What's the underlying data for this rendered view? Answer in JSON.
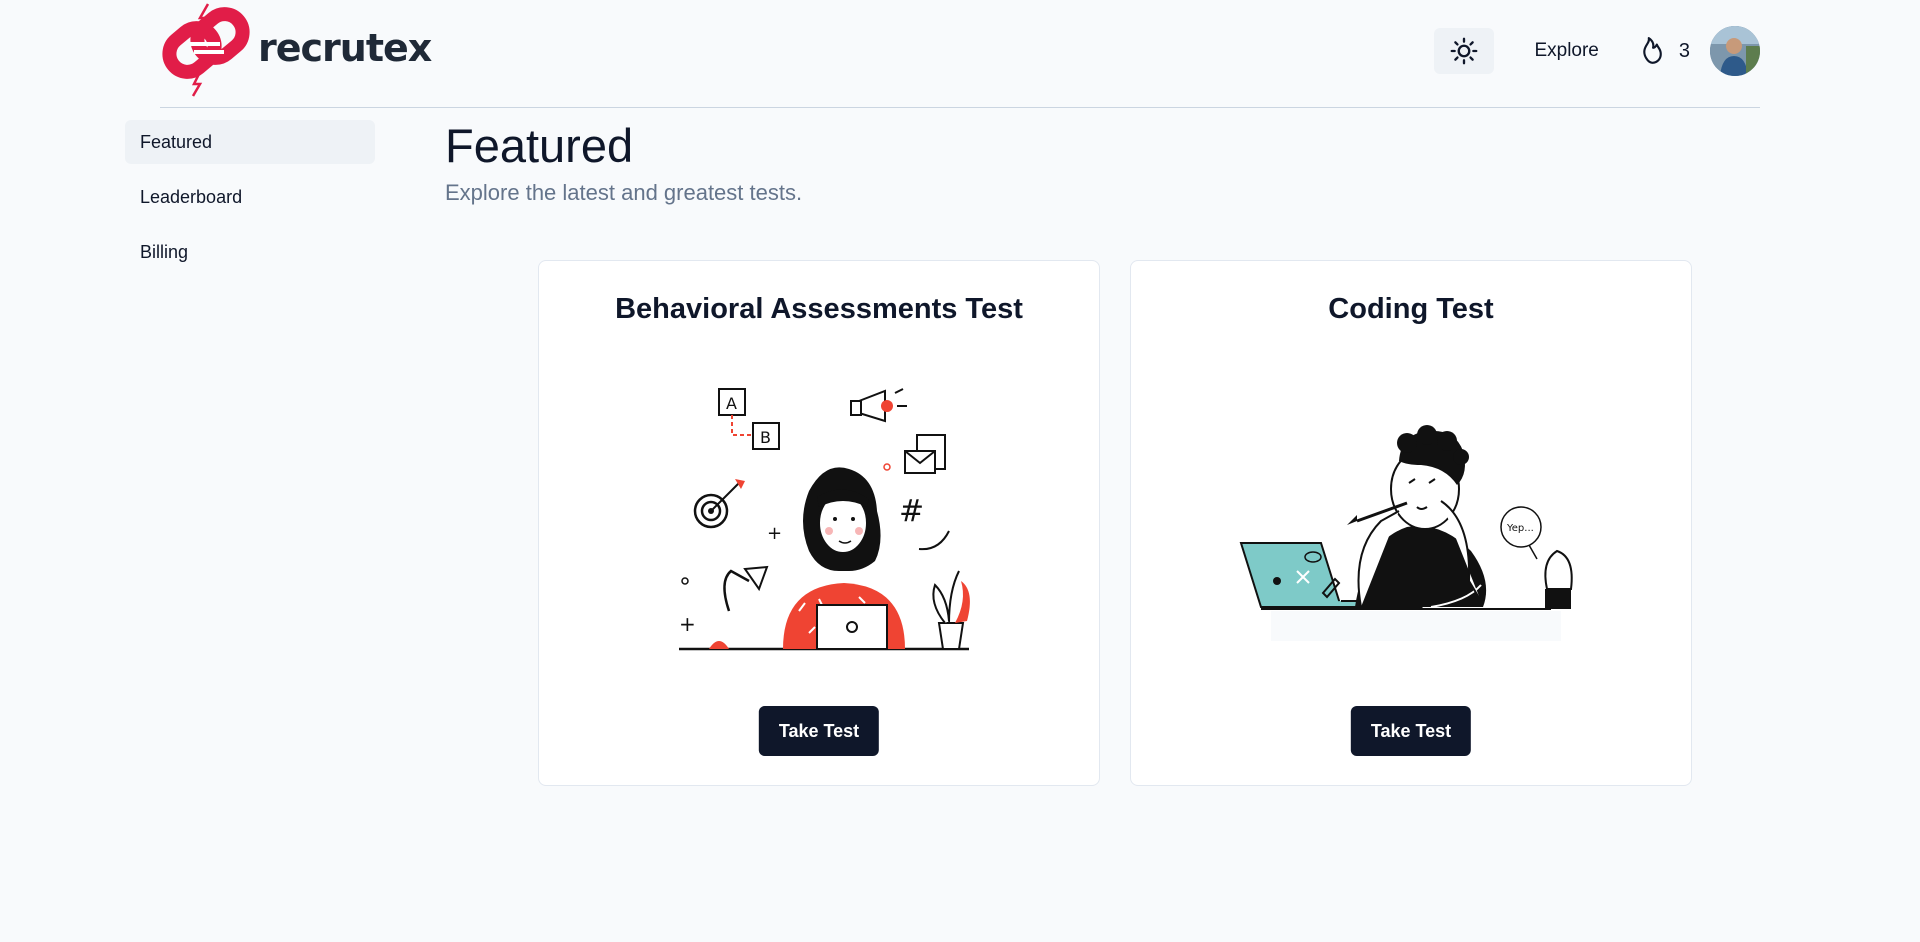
{
  "brand": {
    "name": "recrutex",
    "accent": "#e11d48"
  },
  "header": {
    "theme_icon": "sun-icon",
    "explore_label": "Explore",
    "streak_icon": "flame-icon",
    "streak_count": "3"
  },
  "sidebar": {
    "items": [
      {
        "label": "Featured",
        "active": true
      },
      {
        "label": "Leaderboard",
        "active": false
      },
      {
        "label": "Billing",
        "active": false
      }
    ]
  },
  "main": {
    "title": "Featured",
    "subtitle": "Explore the latest and greatest tests.",
    "cards": [
      {
        "title": "Behavioral Assessments Test",
        "button_label": "Take Test",
        "illustration": "woman-at-laptop-illustration"
      },
      {
        "title": "Coding Test",
        "button_label": "Take Test",
        "illustration": "thinking-person-laptop-illustration"
      }
    ]
  },
  "illustration_text": {
    "bubble": "Yep..."
  },
  "colors": {
    "primary_button": "#0f172a",
    "background": "#f8fafc",
    "illustration_red": "#ef4433",
    "illustration_teal": "#7ecac8"
  }
}
